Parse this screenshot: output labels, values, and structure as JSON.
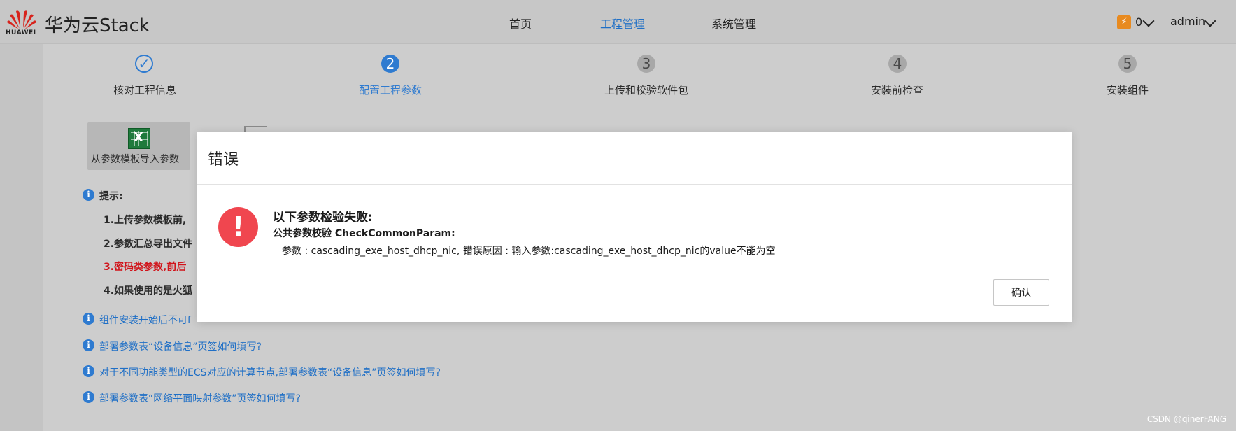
{
  "header": {
    "logo_text": "HUAWEI",
    "brand": "华为云Stack",
    "nav": [
      {
        "label": "首页",
        "active": false
      },
      {
        "label": "工程管理",
        "active": true
      },
      {
        "label": "系统管理",
        "active": false
      }
    ],
    "notification_count": "0",
    "user": "admin",
    "accent_color": "#1f6fc6"
  },
  "stepper": {
    "steps": [
      {
        "number": "✓",
        "label": "核对工程信息",
        "state": "done"
      },
      {
        "number": "2",
        "label": "配置工程参数",
        "state": "current"
      },
      {
        "number": "3",
        "label": "上传和校验软件包",
        "state": "todo"
      },
      {
        "number": "4",
        "label": "安装前检查",
        "state": "todo"
      },
      {
        "number": "5",
        "label": "安装组件",
        "state": "todo"
      }
    ]
  },
  "toolbar": {
    "import_label": "从参数模板导入参数"
  },
  "tips": {
    "title": "提示:",
    "items": [
      {
        "text": "1.上传参数模板前,",
        "style": "normal"
      },
      {
        "text": "2.参数汇总导出文件",
        "style": "normal"
      },
      {
        "text": "3.密码类参数,前后",
        "style": "red"
      },
      {
        "text": "4.如果使用的是火狐",
        "style": "normal"
      }
    ]
  },
  "help_links": [
    "组件安装开始后不可f",
    "部署参数表“设备信息”页签如何填写?",
    "对于不同功能类型的ECS对应的计算节点,部署参数表“设备信息”页签如何填写?",
    "部署参数表“网络平面映射参数”页签如何填写?"
  ],
  "dialog": {
    "title": "错误",
    "error_icon": "!",
    "heading": "以下参数检验失败:",
    "subheading": "公共参数校验 CheckCommonParam:",
    "detail": "参数 : cascading_exe_host_dhcp_nic, 错误原因 : 输入参数:cascading_exe_host_dhcp_nic的value不能为空",
    "confirm_label": "确认",
    "error_color": "#f0464f"
  },
  "watermark": "CSDN @qinerFANG"
}
